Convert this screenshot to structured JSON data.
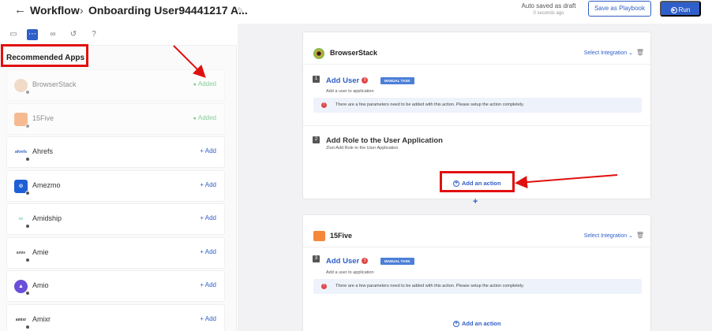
{
  "header": {
    "back_icon": "arrow-left-icon",
    "section": "Workflow",
    "separator": "›",
    "title": "Onboarding User94441217 A...",
    "autosave_label": "Auto saved as draft",
    "autosave_time": "0 seconds ago",
    "playbook_label": "Save as Playbook",
    "run_label": "Run"
  },
  "sidebar": {
    "tools": [
      "comment-icon",
      "workflow-icon",
      "link-icon",
      "history-icon",
      "help-icon"
    ],
    "section_title": "Recommended Apps",
    "apps": [
      {
        "name": "BrowserStack",
        "action": "Added",
        "added": true,
        "logo_color": "#e9c3a0"
      },
      {
        "name": "15Five",
        "action": "Added",
        "added": true,
        "logo_color": "#f5873a"
      },
      {
        "name": "Ahrefs",
        "action": "+ Add",
        "added": false,
        "logo_color": "#ffffff"
      },
      {
        "name": "Amezmo",
        "action": "+ Add",
        "added": false,
        "logo_color": "#1f5fd6"
      },
      {
        "name": "Amidship",
        "action": "+ Add",
        "added": false,
        "logo_color": "#ffffff"
      },
      {
        "name": "Amie",
        "action": "+ Add",
        "added": false,
        "logo_color": "#ffffff"
      },
      {
        "name": "Amio",
        "action": "+ Add",
        "added": false,
        "logo_color": "#6a4fd8"
      },
      {
        "name": "Amixr",
        "action": "+ Add",
        "added": false,
        "logo_color": "#ffffff"
      }
    ]
  },
  "canvas": {
    "card1": {
      "app_name": "BrowserStack",
      "select_integration": "Select Integration",
      "steps": [
        {
          "num": "1",
          "title": "Add User",
          "tag": "MANUAL TASK",
          "subtitle": "Add a user to application"
        },
        {
          "num": "2",
          "title": "Add Role to the User Application",
          "subtitle": "Zluri:Add Role to the User Application"
        }
      ],
      "warning": "There are a few parameters need to be added with this action. Please setup the action completely.",
      "add_action": "Add an action"
    },
    "join_plus": "+",
    "card2": {
      "app_name": "15Five",
      "select_integration": "Select Integration",
      "steps": [
        {
          "num": "3",
          "title": "Add User",
          "tag": "MANUAL TASK",
          "subtitle": "Add a user to application"
        }
      ],
      "warning": "There are a few parameters need to be added with this action. Please setup the action completely.",
      "add_action": "Add an action"
    }
  },
  "colors": {
    "accent": "#2f5fc8",
    "annotation": "#e01010",
    "added": "#2aa84a",
    "warning": "#e04848"
  }
}
